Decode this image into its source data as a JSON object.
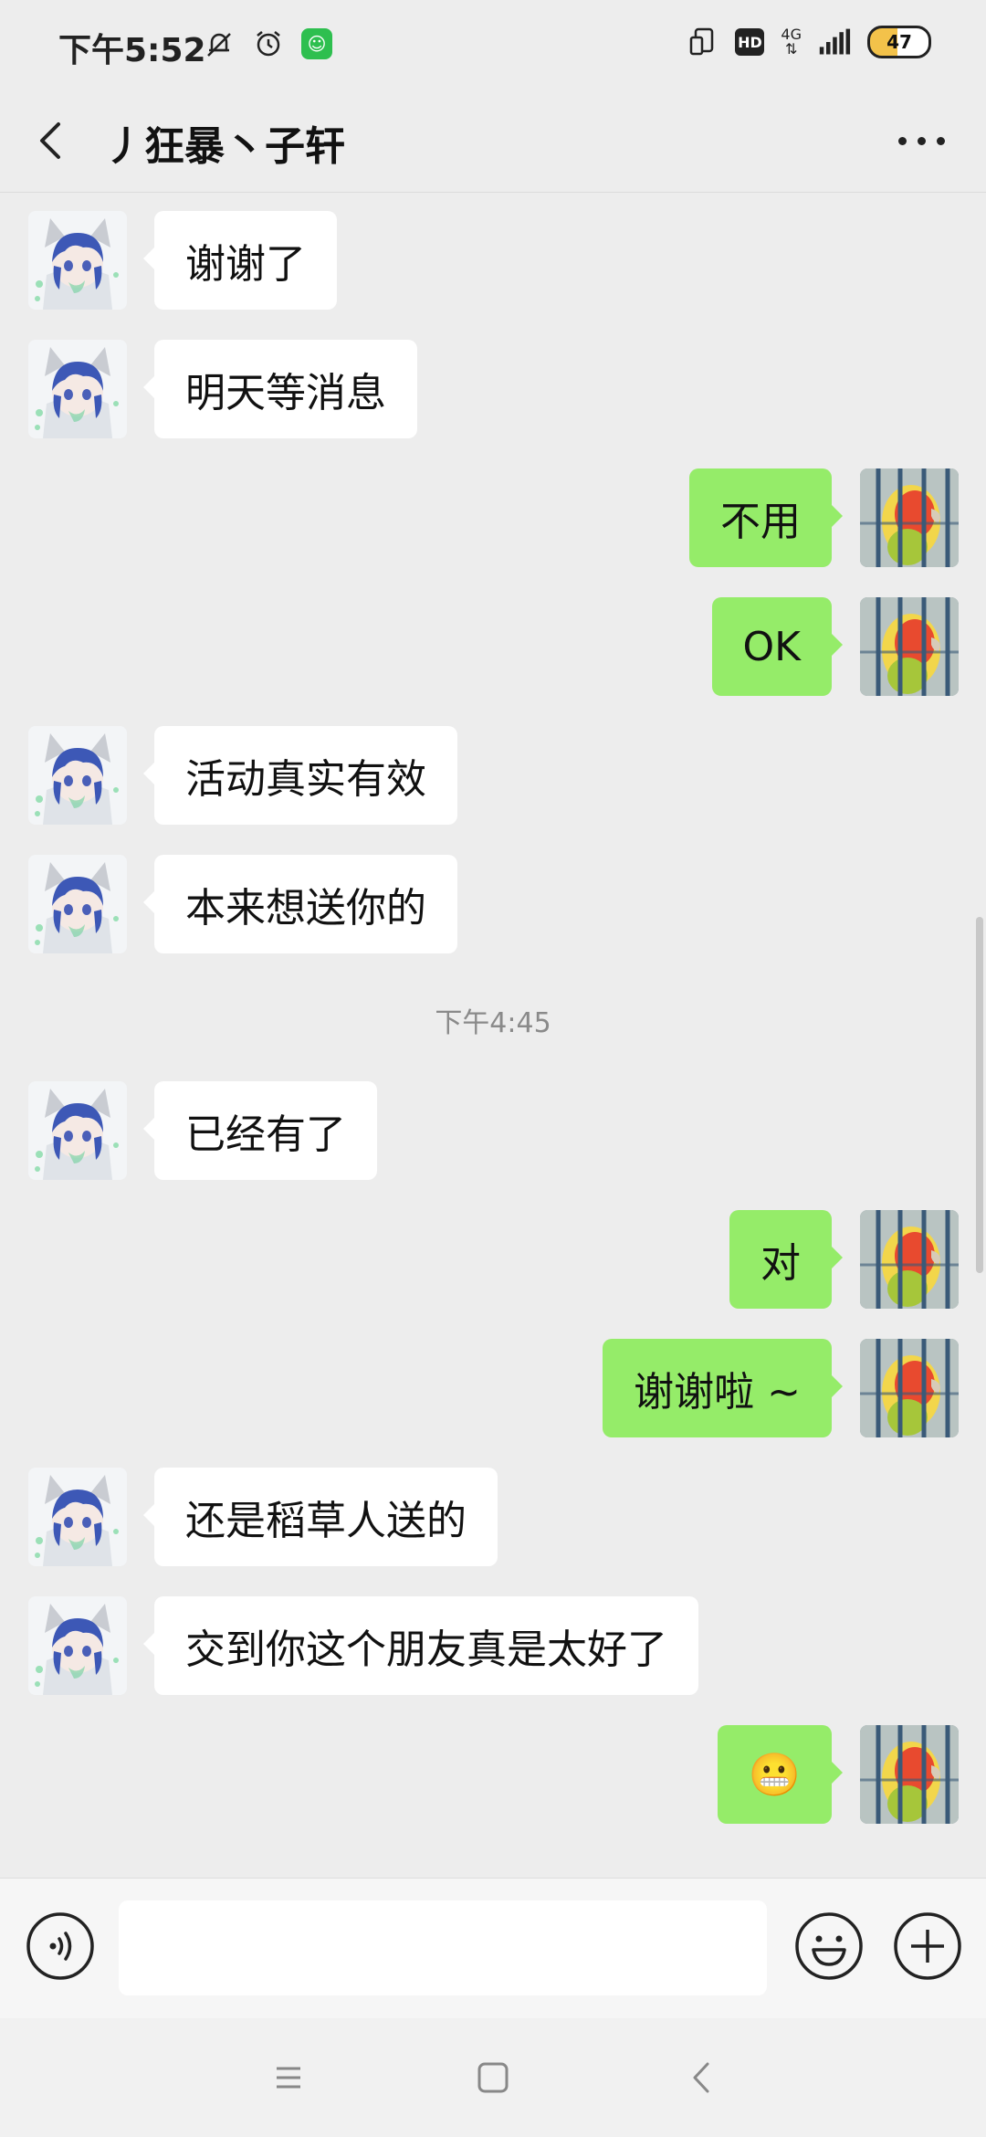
{
  "status_bar": {
    "time": "下午5:52",
    "network": "4G",
    "hd": "HD",
    "battery": "47",
    "app_badge": "☺"
  },
  "header": {
    "title": "丿狂暴丶子轩"
  },
  "messages": [
    {
      "side": "left",
      "text": "谢谢了"
    },
    {
      "side": "left",
      "text": "明天等消息"
    },
    {
      "side": "right",
      "text": "不用"
    },
    {
      "side": "right",
      "text": "OK"
    },
    {
      "side": "left",
      "text": "活动真实有效"
    },
    {
      "side": "left",
      "text": "本来想送你的"
    },
    {
      "timestamp": "下午4:45"
    },
    {
      "side": "left",
      "text": "已经有了"
    },
    {
      "side": "right",
      "text": "对"
    },
    {
      "side": "right",
      "text": "谢谢啦 ~"
    },
    {
      "side": "left",
      "text": "还是稻草人送的"
    },
    {
      "side": "left",
      "text": "交到你这个朋友真是太好了"
    },
    {
      "side": "right",
      "text": "😬"
    }
  ],
  "input": {
    "placeholder": ""
  },
  "colors": {
    "background": "#ededed",
    "sent_bubble": "#95ec69",
    "received_bubble": "#ffffff"
  }
}
